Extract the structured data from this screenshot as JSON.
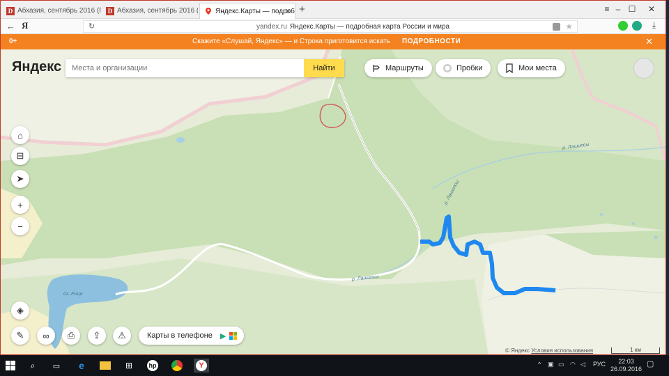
{
  "tabs": [
    {
      "label": "Абхазия, сентябрь 2016 (П"
    },
    {
      "label": "Абхазия, сентябрь 2016 (П"
    },
    {
      "label": "Яндекс.Карты — подробн"
    }
  ],
  "addressbar": {
    "url": "yandex.ru",
    "page_title": "Яндекс.Карты — подробная карта России и мира",
    "browser_logo": "Я"
  },
  "banner": {
    "age": "0+",
    "message": "Скажите «Слушай, Яндекс» — и Строка приготовится искать",
    "details": "ПОДРОБНОСТИ"
  },
  "map": {
    "logo": "Яндекс",
    "search_placeholder": "Места и организации",
    "search_button": "Найти",
    "routes": "Маршруты",
    "traffic": "Пробки",
    "my_places": "Мои места",
    "phone_button": "Карты в телефоне",
    "labels": {
      "river_top_right": "р. Лашипсы",
      "river_center": "р. Лашипсы",
      "river_bottom": "р. Лашипсы",
      "lake": "оз. Рица"
    },
    "copyright": "© Яндекс",
    "terms": "Условия использования",
    "scale": "1 км"
  },
  "taskbar": {
    "lang": "РУС",
    "time": "22:03",
    "date": "26.09.2016"
  },
  "colors": {
    "banner": "#f58220",
    "forest": "#c9dfb5",
    "route": "#1e88f0",
    "search_button": "#ffdb4d"
  }
}
